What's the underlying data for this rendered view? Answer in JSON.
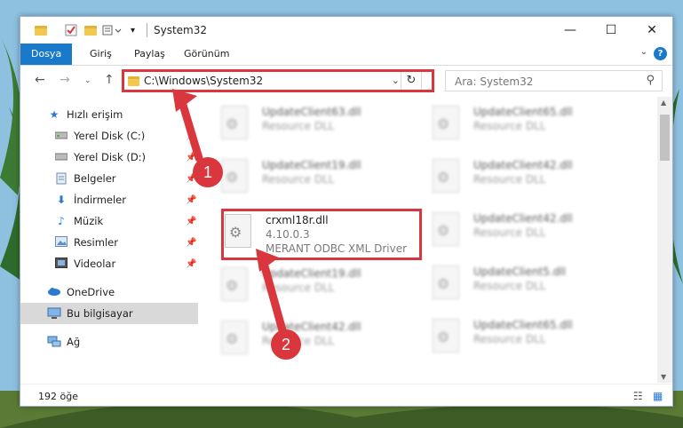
{
  "window": {
    "title": "System32",
    "minimize": "—",
    "maximize": "☐",
    "close": "✕"
  },
  "ribbon": {
    "tabs": [
      "Dosya",
      "Giriş",
      "Paylaş",
      "Görünüm"
    ]
  },
  "nav": {
    "address": "C:\\Windows\\System32",
    "search_placeholder": "Ara: System32"
  },
  "sidebar": {
    "items": [
      {
        "label": "Hızlı erişim",
        "icon": "star-icon"
      },
      {
        "label": "Yerel Disk (C:)",
        "icon": "drive-icon"
      },
      {
        "label": "Yerel Disk (D:)",
        "icon": "drive-icon"
      },
      {
        "label": "Belgeler",
        "icon": "documents-icon"
      },
      {
        "label": "İndirmeler",
        "icon": "download-icon"
      },
      {
        "label": "Müzik",
        "icon": "music-icon"
      },
      {
        "label": "Resimler",
        "icon": "pictures-icon"
      },
      {
        "label": "Videolar",
        "icon": "video-icon"
      },
      {
        "label": "OneDrive",
        "icon": "cloud-icon"
      },
      {
        "label": "Bu bilgisayar",
        "icon": "computer-icon"
      },
      {
        "label": "Ağ",
        "icon": "network-icon"
      }
    ]
  },
  "files": [
    {
      "name": "UpdateClient63.dll",
      "type": "Resource DLL"
    },
    {
      "name": "UpdateClient65.dll",
      "type": "Resource DLL"
    },
    {
      "name": "UpdateClient19.dll",
      "type": "Resource DLL"
    },
    {
      "name": "UpdateClient42.dll",
      "type": "Resource DLL"
    },
    {
      "name": "crxml18r.dll",
      "version": "4.10.0.3",
      "type": "MERANT ODBC XML Driver"
    },
    {
      "name": "UpdateClient42.dll",
      "type": "Resource DLL"
    },
    {
      "name": "UpdateClient19.dll",
      "type": "Resource DLL"
    },
    {
      "name": "UpdateClient5.dll",
      "type": "Resource DLL"
    },
    {
      "name": "UpdateClient42.dll",
      "type": "Resource DLL"
    },
    {
      "name": "UpdateClient65.dll",
      "type": "Resource DLL"
    }
  ],
  "status": {
    "count": "192 öğe"
  },
  "annotations": [
    "1",
    "2"
  ],
  "colors": {
    "accent": "#1979ca",
    "highlight": "#d9363e"
  }
}
